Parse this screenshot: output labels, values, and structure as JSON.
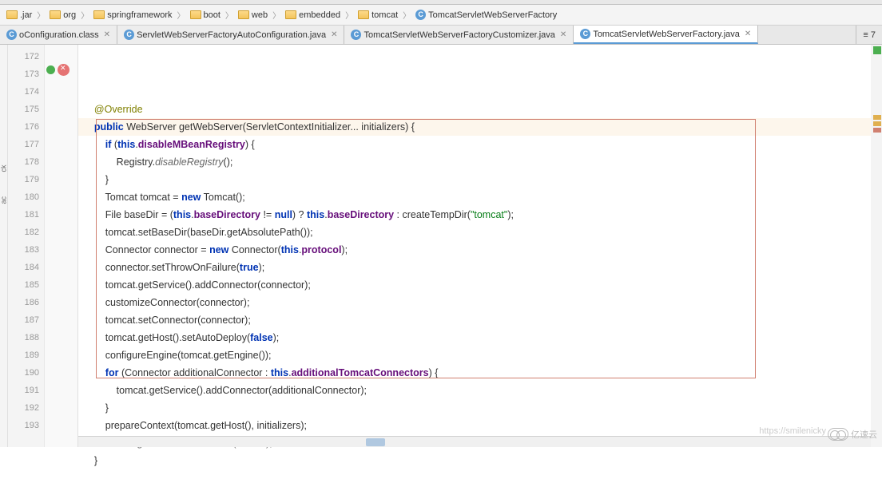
{
  "breadcrumb": [
    {
      "icon": "jar",
      "label": ".jar"
    },
    {
      "icon": "folder",
      "label": "org"
    },
    {
      "icon": "folder",
      "label": "springframework"
    },
    {
      "icon": "folder",
      "label": "boot"
    },
    {
      "icon": "folder",
      "label": "web"
    },
    {
      "icon": "folder",
      "label": "embedded"
    },
    {
      "icon": "folder",
      "label": "tomcat"
    },
    {
      "icon": "class",
      "label": "TomcatServletWebServerFactory"
    }
  ],
  "tabs": [
    {
      "label": "oConfiguration.class",
      "active": false
    },
    {
      "label": "ServletWebServerFactoryAutoConfiguration.java",
      "active": false
    },
    {
      "label": "TomcatServletWebServerFactoryCustomizer.java",
      "active": false
    },
    {
      "label": "TomcatServletWebServerFactory.java",
      "active": true
    }
  ],
  "right_tab": "≡ 7",
  "line_start": 172,
  "line_end": 193,
  "code_lines": [
    {
      "n": 172,
      "html": "    <span class='ann'>@Override</span>"
    },
    {
      "n": 173,
      "hl": true,
      "html": "    <span class='kw'>public</span> WebServer getWebServer(ServletContextInitializer... initializers) {"
    },
    {
      "n": 174,
      "html": "        <span class='kw'>if</span> (<span class='kw'>this</span>.<span class='fld'>disableMBeanRegistry</span>) {"
    },
    {
      "n": 175,
      "html": "            Registry.<span class='it'>disableRegistry</span>();"
    },
    {
      "n": 176,
      "html": "        }"
    },
    {
      "n": 177,
      "html": "        Tomcat tomcat = <span class='kw'>new</span> Tomcat();"
    },
    {
      "n": 178,
      "html": "        File baseDir = (<span class='kw'>this</span>.<span class='fld'>baseDirectory</span> != <span class='kw'>null</span>) ? <span class='kw'>this</span>.<span class='fld'>baseDirectory</span> : createTempDir(<span class='str'>\"tomcat\"</span>);"
    },
    {
      "n": 179,
      "html": "        tomcat.setBaseDir(baseDir.getAbsolutePath());"
    },
    {
      "n": 180,
      "html": "        Connector connector = <span class='kw'>new</span> Connector(<span class='kw'>this</span>.<span class='fld'>protocol</span>);"
    },
    {
      "n": 181,
      "html": "        connector.setThrowOnFailure(<span class='kw'>true</span>);"
    },
    {
      "n": 182,
      "html": "        tomcat.getService().addConnector(connector);"
    },
    {
      "n": 183,
      "html": "        customizeConnector(connector);"
    },
    {
      "n": 184,
      "html": "        tomcat.setConnector(connector);"
    },
    {
      "n": 185,
      "html": "        tomcat.getHost().setAutoDeploy(<span class='kw'>false</span>);"
    },
    {
      "n": 186,
      "html": "        configureEngine(tomcat.getEngine());"
    },
    {
      "n": 187,
      "html": "        <span class='kw'>for</span> (Connector additionalConnector : <span class='kw'>this</span>.<span class='fld'>additionalTomcatConnectors</span>) {"
    },
    {
      "n": 188,
      "html": "            tomcat.getService().addConnector(additionalConnector);"
    },
    {
      "n": 189,
      "html": "        }"
    },
    {
      "n": 190,
      "html": "        prepareContext(tomcat.getHost(), initializers);"
    },
    {
      "n": 191,
      "html": "        <span class='kw'>return</span> <span class='st'>getTomcatWebServer(tomcat);</span>"
    },
    {
      "n": 192,
      "html": "    }"
    },
    {
      "n": 193,
      "html": ""
    }
  ],
  "left_labels": [
    "ck",
    "ac"
  ],
  "watermark_url": "https://smilenicky",
  "logo_text": "亿速云"
}
